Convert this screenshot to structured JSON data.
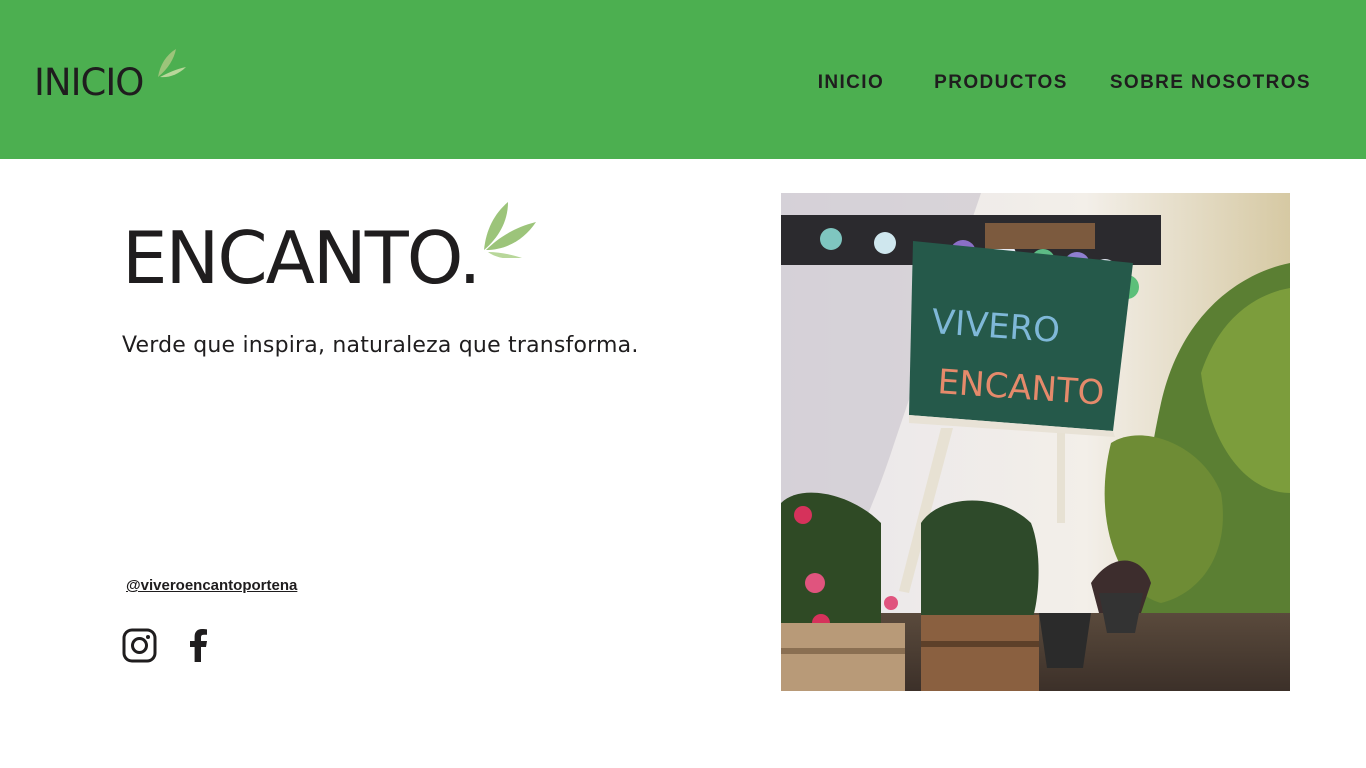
{
  "header": {
    "logo_text": "INICIO",
    "background_color": "#4caf50",
    "nav": [
      "INICIO",
      "PRODUCTOS",
      "SOBRE NOSOTROS"
    ]
  },
  "hero": {
    "brand": "ENCANTO.",
    "tagline": "Verde que inspira, naturaleza que transforma.",
    "handle": "@viveroencantoportena",
    "social_icons": [
      "instagram-icon",
      "facebook-icon"
    ],
    "leaf_color": "#9cc47a"
  },
  "photo": {
    "sign_line1": "VIVERO",
    "sign_line2": "ENCANTO"
  }
}
